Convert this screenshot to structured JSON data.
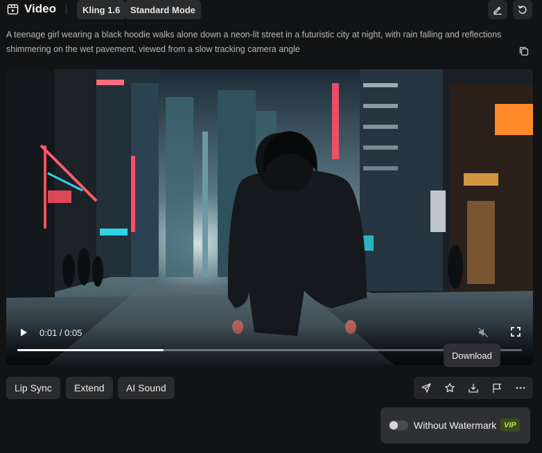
{
  "header": {
    "title": "Video",
    "model_chip": "Kling 1.6",
    "mode_chip": "Standard Mode"
  },
  "prompt": {
    "text": "A teenage girl wearing a black hoodie walks alone down a neon-lit street in a futuristic city at night, with rain falling and reflections shimmering on the wet pavement, viewed from a slow tracking camera angle"
  },
  "player": {
    "current_time": "0:01",
    "duration": "0:05",
    "time_display": "0:01 / 0:05",
    "progress_fraction": 0.29
  },
  "tooltip": {
    "text": "Download"
  },
  "actions": {
    "lip_sync": "Lip Sync",
    "extend": "Extend",
    "ai_sound": "AI Sound"
  },
  "watermark": {
    "label": "Without Watermark",
    "badge": "VIP",
    "enabled": false
  },
  "icons": {
    "title": "video-icon",
    "edit": "pencil-icon",
    "undo": "undo-icon",
    "copy": "copy-icon",
    "play": "play-icon",
    "mute": "mute-icon",
    "fullscreen": "fullscreen-icon",
    "share": "send-icon",
    "favorite": "star-icon",
    "download": "download-icon",
    "report": "flag-icon",
    "more": "more-icon"
  },
  "colors": {
    "background": "#121314",
    "chip": "#2a2b2d",
    "vip_text": "#b8e34c",
    "vip_bg": "#3b4a1f"
  }
}
